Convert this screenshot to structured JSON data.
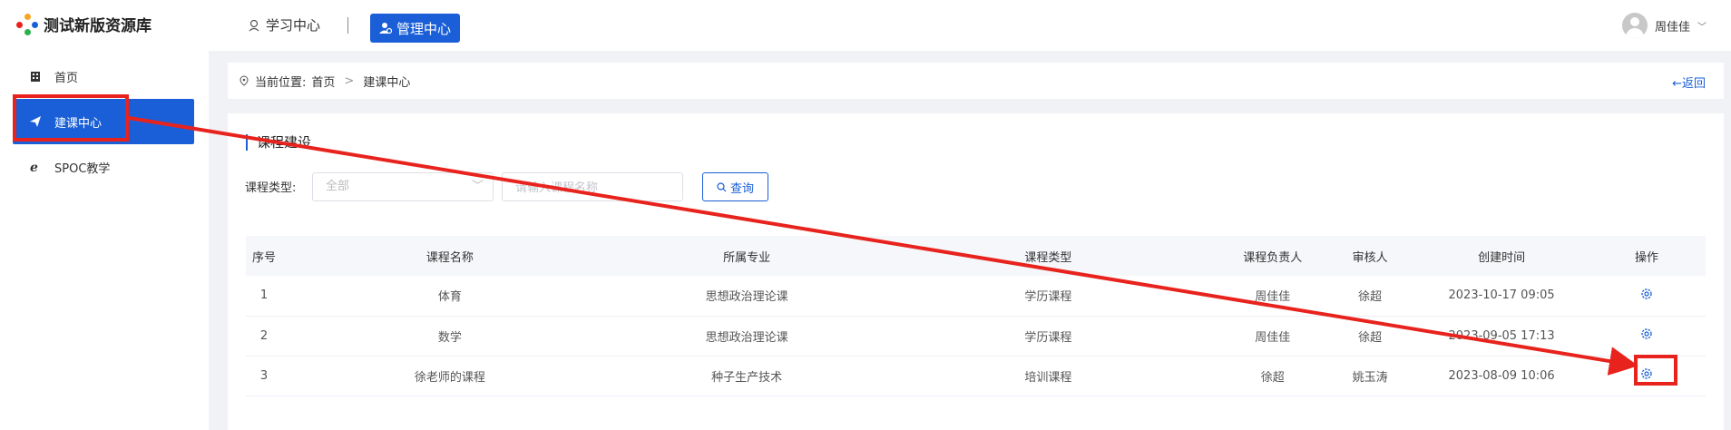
{
  "header": {
    "app_title": "测试新版资源库",
    "nav_learning": "学习中心",
    "nav_manage": "管理中心",
    "user_name": "周佳佳"
  },
  "sidebar": {
    "items": [
      {
        "label": "首页",
        "icon": "building-icon"
      },
      {
        "label": "建课中心",
        "icon": "paper-plane-icon"
      },
      {
        "label": "SPOC教学",
        "icon": "ie-icon"
      }
    ]
  },
  "breadcrumb": {
    "prefix": "当前位置:",
    "home": "首页",
    "current": "建课中心",
    "back": "←返回"
  },
  "section": {
    "title": "课程建设"
  },
  "filters": {
    "type_label": "课程类型:",
    "type_value": "全部",
    "name_placeholder": "请输入课程名称",
    "query_label": "查询"
  },
  "table": {
    "headers": [
      "序号",
      "课程名称",
      "所属专业",
      "课程类型",
      "课程负责人",
      "审核人",
      "创建时间",
      "操作"
    ],
    "rows": [
      {
        "no": "1",
        "name": "体育",
        "major": "思想政治理论课",
        "type": "学历课程",
        "owner": "周佳佳",
        "reviewer": "徐超",
        "created": "2023-10-17 09:05"
      },
      {
        "no": "2",
        "name": "数学",
        "major": "思想政治理论课",
        "type": "学历课程",
        "owner": "周佳佳",
        "reviewer": "徐超",
        "created": "2023-09-05 17:13"
      },
      {
        "no": "3",
        "name": "徐老师的课程",
        "major": "种子生产技术",
        "type": "培训课程",
        "owner": "徐超",
        "reviewer": "姚玉涛",
        "created": "2023-08-09 10:06"
      }
    ]
  },
  "colors": {
    "primary": "#1a5fd7",
    "annotation": "#e8231d"
  }
}
